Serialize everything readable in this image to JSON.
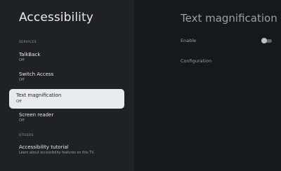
{
  "header": {
    "title": "Accessibility"
  },
  "sections": {
    "services_label": "SERVICES",
    "others_label": "OTHERS"
  },
  "items": [
    {
      "label": "TalkBack",
      "sub": "Off"
    },
    {
      "label": "Switch Access",
      "sub": "Off"
    },
    {
      "label": "Text magnification",
      "sub": "Off"
    },
    {
      "label": "Screen reader",
      "sub": "Off"
    },
    {
      "label": "Accessibility tutorial",
      "sub": "Learn about accessibility features on this TV."
    }
  ],
  "detail": {
    "title": "Text magnification",
    "enable_label": "Enable",
    "enable_state": "off",
    "configuration_label": "Configuration"
  }
}
